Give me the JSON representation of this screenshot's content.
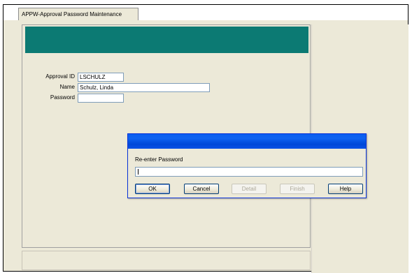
{
  "window": {
    "tab_label": "APPW-Approval Password Maintenance"
  },
  "form": {
    "approval_id_label": "Approval ID",
    "approval_id_value": "LSCHULZ",
    "name_label": "Name",
    "name_value": "Schulz, Linda",
    "password_label": "Password",
    "password_value": ""
  },
  "dialog": {
    "prompt": "Re-enter Password",
    "input_value": "",
    "buttons": {
      "ok": "OK",
      "cancel": "Cancel",
      "detail": "Detail",
      "finish": "Finish",
      "help": "Help"
    }
  },
  "colors": {
    "banner": "#0c7a73",
    "titlebar": "#0a5ef0"
  }
}
